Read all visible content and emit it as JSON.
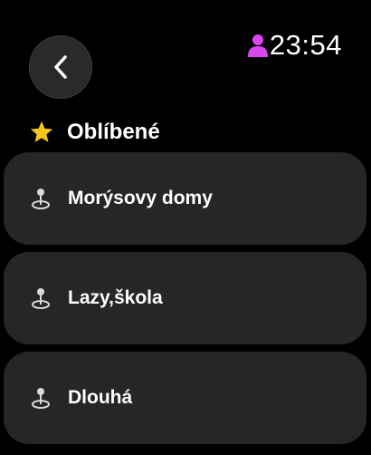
{
  "status": {
    "time": "23:54",
    "user_icon": "person-icon",
    "user_icon_color": "#d946ef"
  },
  "nav": {
    "back_icon": "chevron-left-icon"
  },
  "favorites": {
    "title": "Oblíbené",
    "icon": "star-icon",
    "icon_color": "#f5c518",
    "items": [
      {
        "label": "Morýsovy domy",
        "icon": "map-pin-icon"
      },
      {
        "label": "Lazy,škola",
        "icon": "map-pin-icon"
      },
      {
        "label": "Dlouhá",
        "icon": "map-pin-icon"
      }
    ]
  }
}
